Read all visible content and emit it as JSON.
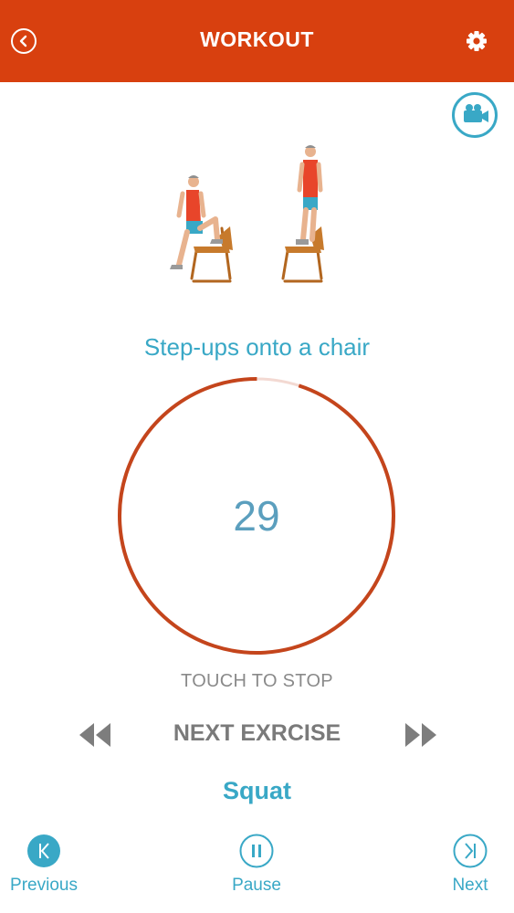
{
  "header": {
    "title": "WORKOUT",
    "back_icon": "chevron-left-icon",
    "settings_icon": "gear-icon",
    "color": "#d8400f"
  },
  "video_button": {
    "icon": "video-camera-icon"
  },
  "exercise": {
    "name": "Step-ups onto a chair",
    "illustration": "person stepping onto chair"
  },
  "timer": {
    "value": "29",
    "progress_remaining": 0.95,
    "ring_color": "#c4451c",
    "track_color": "#f3d9d2"
  },
  "touch_hint": "TOUCH TO STOP",
  "next_section": {
    "label": "NEXT EXRCISE",
    "exercise": "Squat",
    "rewind_icon": "rewind-icon",
    "forward_icon": "fast-forward-icon"
  },
  "bottom_nav": {
    "previous": {
      "label": "Previous",
      "icon": "skip-previous-icon"
    },
    "pause": {
      "label": "Pause",
      "icon": "pause-icon"
    },
    "next": {
      "label": "Next",
      "icon": "skip-next-icon"
    }
  },
  "accent_color": "#39a8c6"
}
